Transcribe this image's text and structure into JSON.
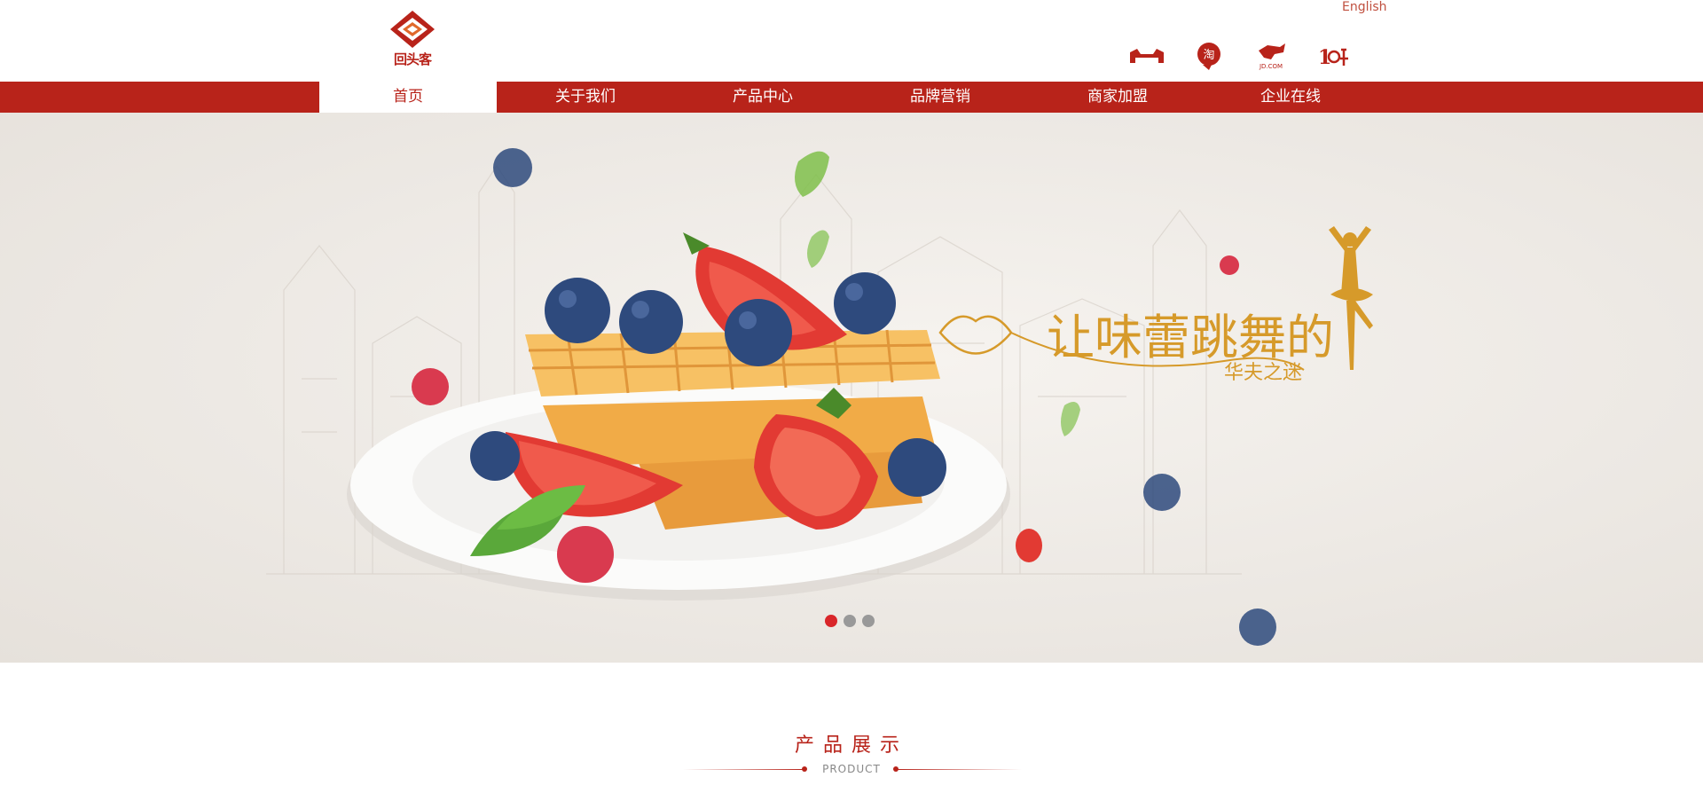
{
  "header": {
    "logo_text": "回头客",
    "language_link": "English",
    "shop_icons": [
      "tmall-icon",
      "taobao-icon",
      "jd-icon",
      "yhd-icon"
    ],
    "jd_label": "JD.COM"
  },
  "nav": {
    "items": [
      {
        "label": "首页",
        "active": true
      },
      {
        "label": "关于我们"
      },
      {
        "label": "产品中心"
      },
      {
        "label": "品牌营销"
      },
      {
        "label": "商家加盟"
      },
      {
        "label": "企业在线"
      }
    ]
  },
  "banner": {
    "slogan_main": "让味蕾跳舞的",
    "slogan_sub": "华夫之迷",
    "slide_count": 3,
    "active_slide": 1
  },
  "section": {
    "title": "产品展示",
    "subtitle": "PRODUCT"
  },
  "colors": {
    "brand_red": "#b8231a",
    "gold": "#d69a2a",
    "dot_active": "#d9262a"
  }
}
